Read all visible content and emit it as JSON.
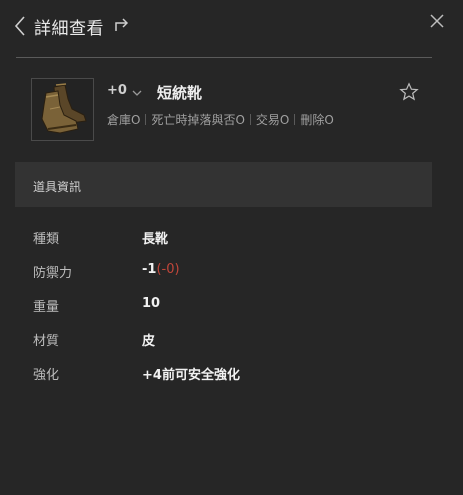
{
  "header": {
    "title": "詳細查看"
  },
  "item": {
    "enhance_level": "+0",
    "name": "短統靴",
    "icon": "leather-boots-icon",
    "tags": [
      "倉庫O",
      "死亡時掉落與否O",
      "交易O",
      "刪除O"
    ]
  },
  "section": {
    "title": "道具資訊"
  },
  "properties": [
    {
      "label": "種類",
      "value": "長靴"
    },
    {
      "label": "防禦力",
      "value": "-1",
      "extra": "(-0)"
    },
    {
      "label": "重量",
      "value": "10"
    },
    {
      "label": "材質",
      "value": "皮"
    },
    {
      "label": "強化",
      "value": "+4前可安全強化"
    }
  ],
  "colors": {
    "background": "#262626",
    "section_bar": "#333333",
    "negative_value": "#c0463a"
  }
}
